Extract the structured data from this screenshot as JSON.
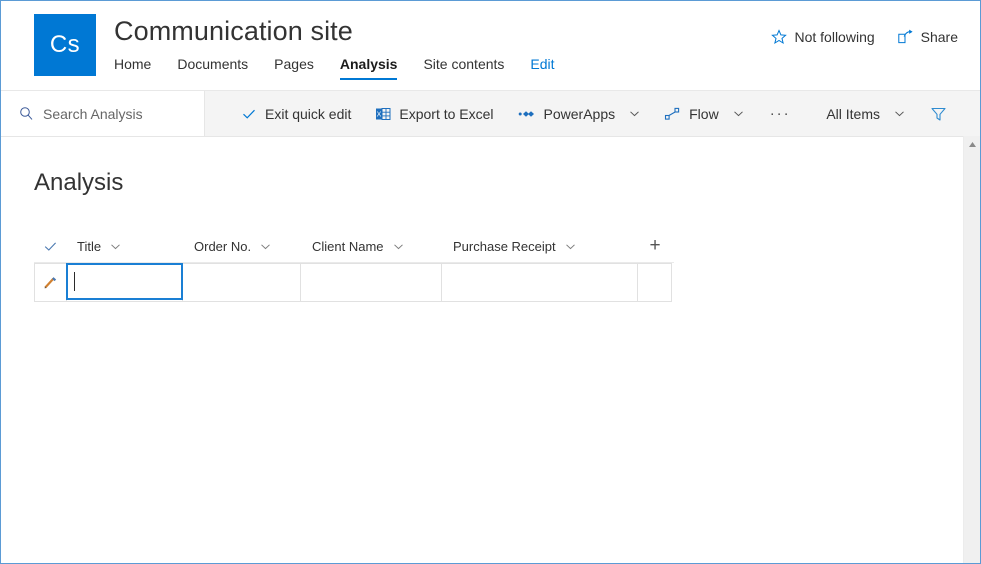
{
  "window": {
    "border_color": "#5b9bd5"
  },
  "header": {
    "logo_text": "Cs",
    "logo_color": "#0078d4",
    "site_title": "Communication site",
    "nav": [
      {
        "label": "Home",
        "active": false,
        "style": "normal"
      },
      {
        "label": "Documents",
        "active": false,
        "style": "normal"
      },
      {
        "label": "Pages",
        "active": false,
        "style": "normal"
      },
      {
        "label": "Analysis",
        "active": true,
        "style": "normal"
      },
      {
        "label": "Site contents",
        "active": false,
        "style": "normal"
      },
      {
        "label": "Edit",
        "active": false,
        "style": "link"
      }
    ],
    "actions": [
      {
        "label": "Not following",
        "icon": "star-icon"
      },
      {
        "label": "Share",
        "icon": "share-icon"
      }
    ]
  },
  "command_bar": {
    "search": {
      "placeholder": "Search Analysis",
      "icon": "search-icon",
      "value": ""
    },
    "commands": [
      {
        "label": "Exit quick edit",
        "icon": "checkmark-icon",
        "has_chevron": false
      },
      {
        "label": "Export to Excel",
        "icon": "excel-icon",
        "has_chevron": false
      },
      {
        "label": "PowerApps",
        "icon": "powerapps-icon",
        "has_chevron": true
      },
      {
        "label": "Flow",
        "icon": "flow-icon",
        "has_chevron": true
      }
    ],
    "overflow_label": "···",
    "view_selector": {
      "label": "All Items",
      "has_chevron": true
    },
    "filter_icon": "filter-funnel-icon"
  },
  "main": {
    "list_title": "Analysis",
    "columns": [
      {
        "label": "Title",
        "has_chevron": true
      },
      {
        "label": "Order No.",
        "has_chevron": true
      },
      {
        "label": "Client Name",
        "has_chevron": true
      },
      {
        "label": "Purchase Receipt",
        "has_chevron": true
      }
    ],
    "add_column_label": "+",
    "select_all_icon": "checkmark-icon",
    "rows": [
      {
        "edit_icon": "pencil-icon",
        "cells": {
          "title": "",
          "order_no": "",
          "client_name": "",
          "purchase_receipt": ""
        },
        "active_cell": "title"
      }
    ]
  },
  "scrollbar": {
    "up_arrow_icon": "chevron-up-icon",
    "position": "top"
  },
  "colors": {
    "accent": "#0078d4",
    "focus_border": "#1a7fd4",
    "command_bar_bg": "#f4f4f4",
    "grid_border": "#e1e1e1"
  }
}
